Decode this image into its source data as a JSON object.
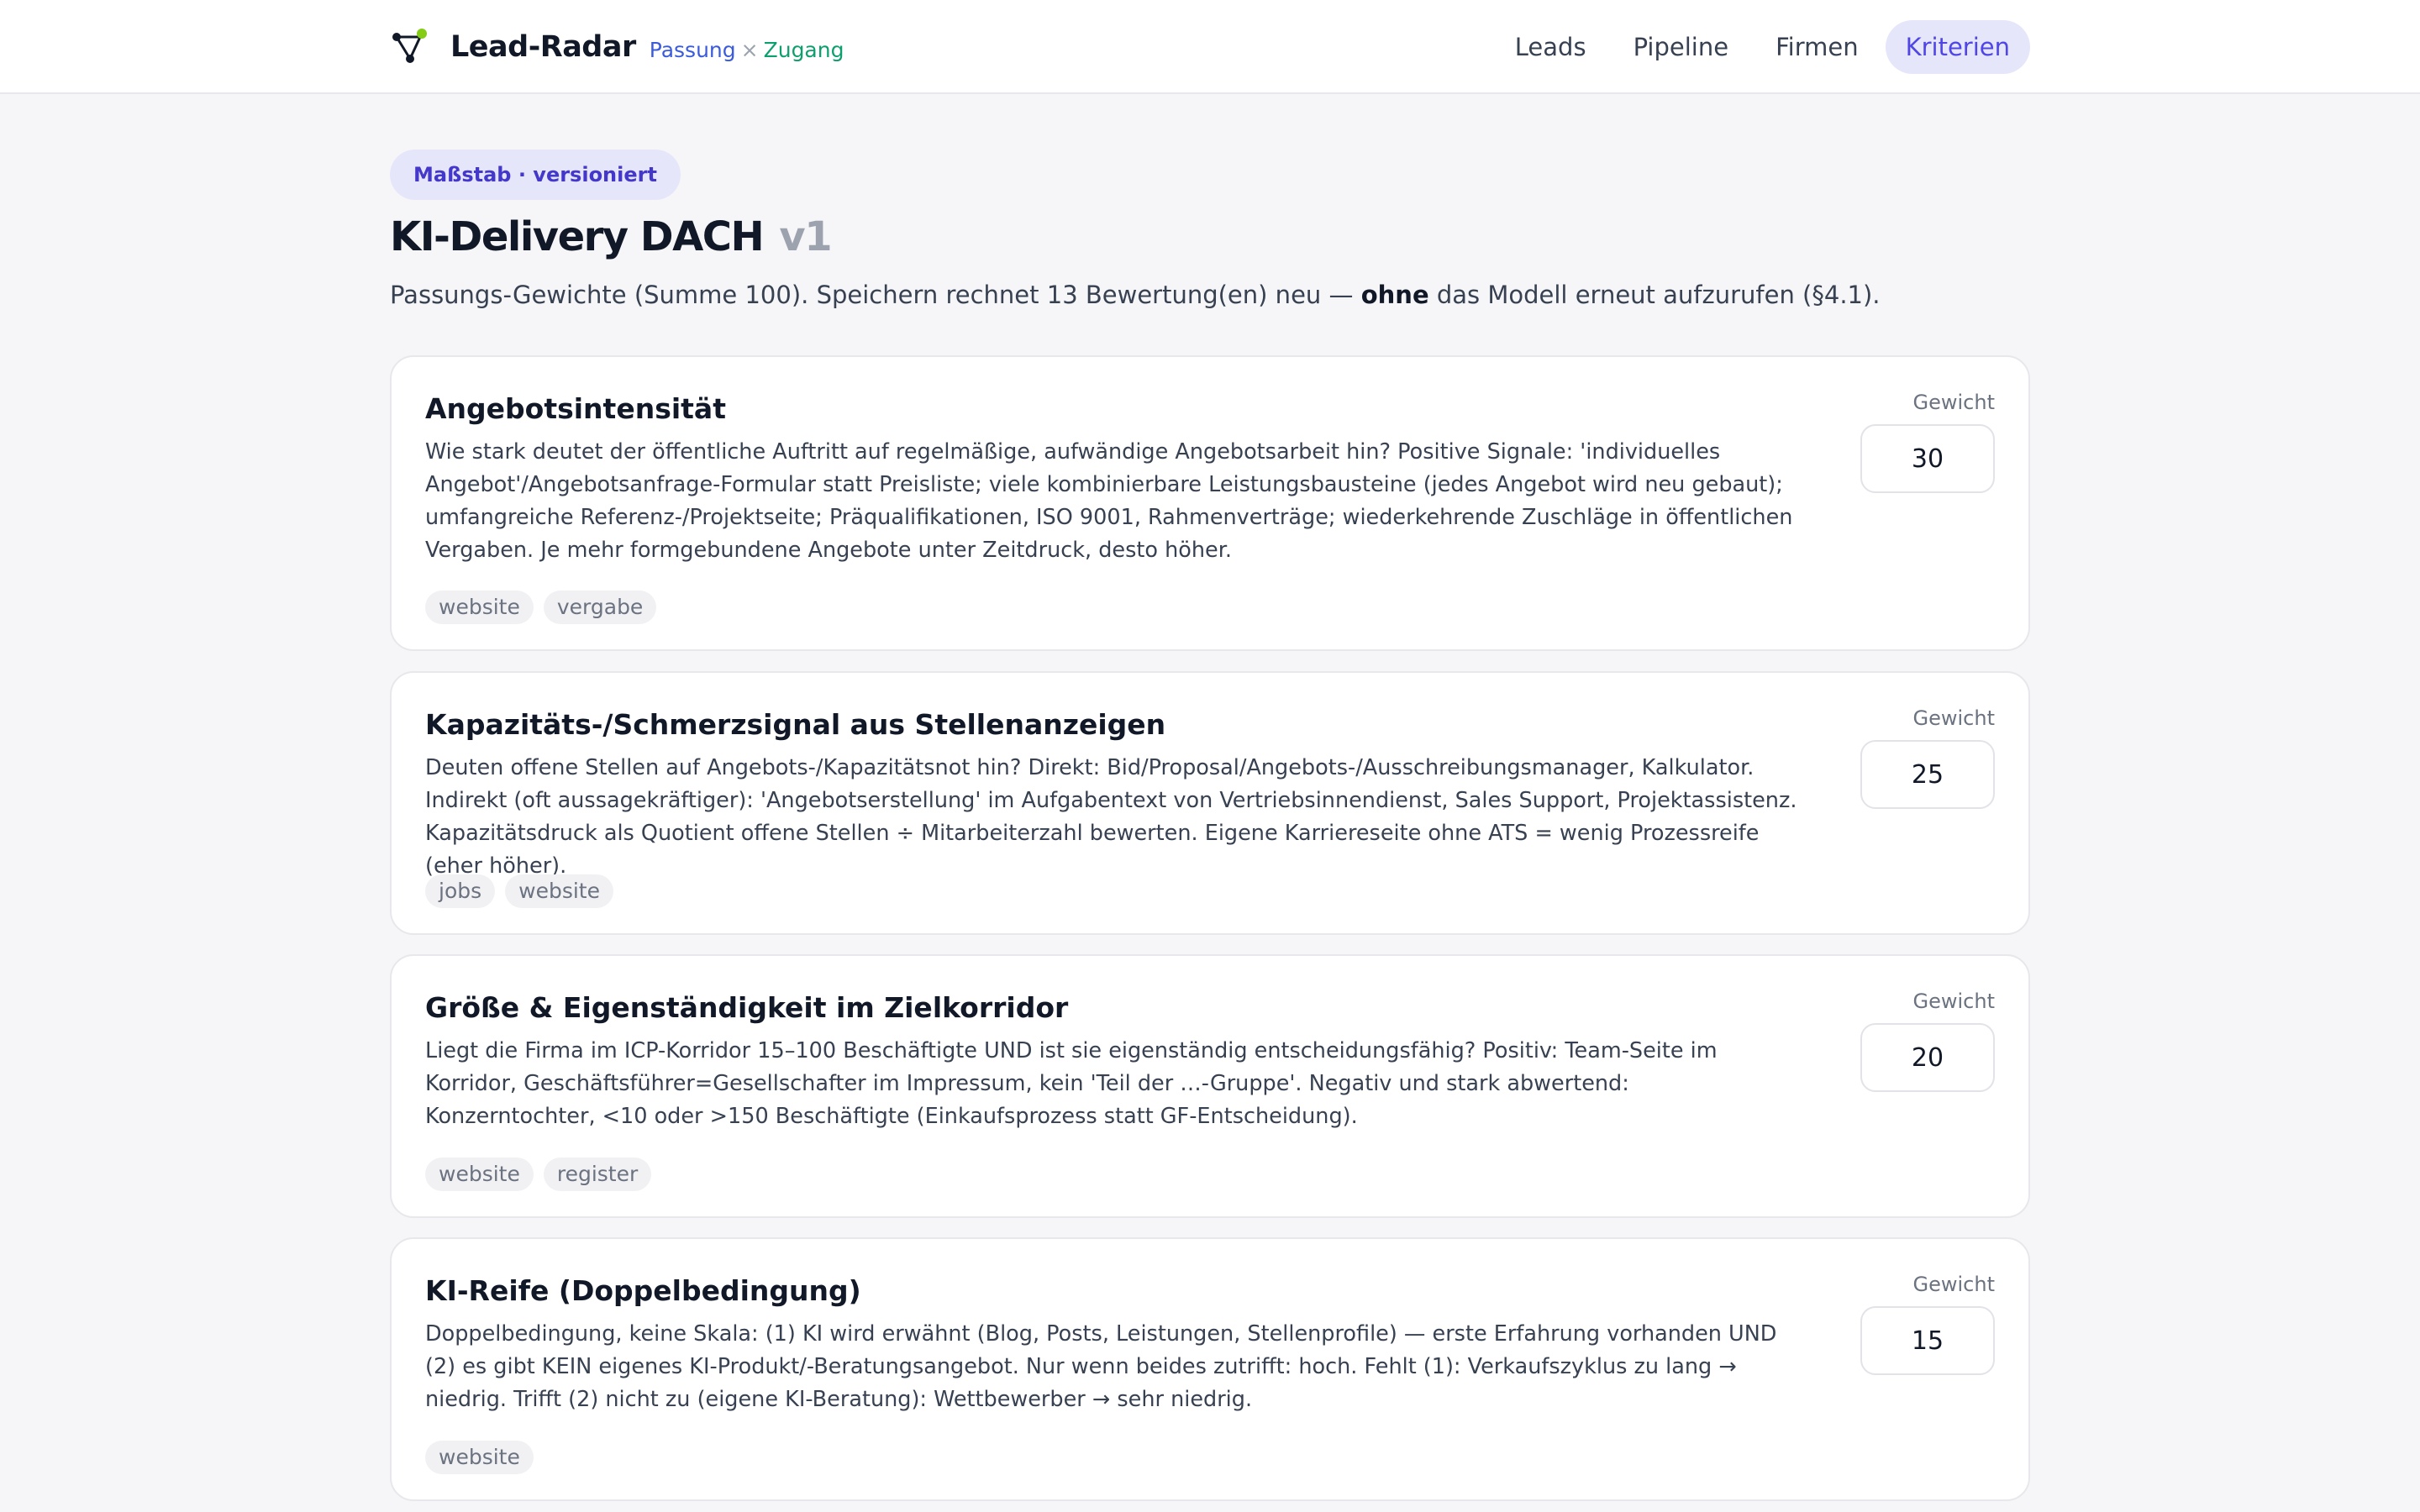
{
  "header": {
    "brand_name": "Lead-Radar",
    "tagline": {
      "left": "Passung",
      "sep": "×",
      "right": "Zugang"
    },
    "nav": [
      {
        "label": "Leads",
        "active": false
      },
      {
        "label": "Pipeline",
        "active": false
      },
      {
        "label": "Firmen",
        "active": false
      },
      {
        "label": "Kriterien",
        "active": true
      }
    ]
  },
  "page": {
    "badge": "Maßstab · versioniert",
    "title": "KI-Delivery DACH",
    "version": "v1",
    "subtitle_pre": "Passungs-Gewichte (Summe 100). Speichern rechnet 13 Bewertung(en) neu — ",
    "subtitle_bold": "ohne",
    "subtitle_post": " das Modell erneut aufzurufen (§4.1)."
  },
  "weight_label": "Gewicht",
  "criteria": [
    {
      "title": "Angebotsintensität",
      "description": "Wie stark deutet der öffentliche Auftritt auf regelmäßige, aufwändige Angebotsarbeit hin? Positive Signale: 'individuelles Angebot'/Angebotsanfrage-Formular statt Preisliste; viele kombinierbare Leistungsbausteine (jedes Angebot wird neu gebaut); umfangreiche Referenz-/Projektseite; Präqualifikationen, ISO 9001, Rahmenverträge; wiederkehrende Zuschläge in öffentlichen Vergaben. Je mehr formgebundene Angebote unter Zeitdruck, desto höher.",
      "tags": [
        "website",
        "vergabe"
      ],
      "weight": "30"
    },
    {
      "title": "Kapazitäts-/Schmerzsignal aus Stellenanzeigen",
      "description": "Deuten offene Stellen auf Angebots-/Kapazitätsnot hin? Direkt: Bid/Proposal/Angebots-/Ausschreibungsmanager, Kalkulator. Indirekt (oft aussagekräftiger): 'Angebotserstellung' im Aufgabentext von Vertriebsinnendienst, Sales Support, Projektassistenz. Kapazitätsdruck als Quotient offene Stellen ÷ Mitarbeiterzahl bewerten. Eigene Karriereseite ohne ATS = wenig Prozessreife (eher höher).",
      "tags": [
        "jobs",
        "website"
      ],
      "weight": "25"
    },
    {
      "title": "Größe & Eigenständigkeit im Zielkorridor",
      "description": "Liegt die Firma im ICP-Korridor 15–100 Beschäftigte UND ist sie eigenständig entscheidungsfähig? Positiv: Team-Seite im Korridor, Geschäftsführer=Gesellschafter im Impressum, kein 'Teil der …-Gruppe'. Negativ und stark abwertend: Konzerntochter, <10 oder >150 Beschäftigte (Einkaufsprozess statt GF-Entscheidung).",
      "tags": [
        "website",
        "register"
      ],
      "weight": "20"
    },
    {
      "title": "KI-Reife (Doppelbedingung)",
      "description": "Doppelbedingung, keine Skala: (1) KI wird erwähnt (Blog, Posts, Leistungen, Stellenprofile) — erste Erfahrung vorhanden UND (2) es gibt KEIN eigenes KI-Produkt/-Beratungsangebot. Nur wenn beides zutrifft: hoch. Fehlt (1): Verkaufszyklus zu lang → niedrig. Trifft (2) nicht zu (eigene KI-Beratung): Wettbewerber → sehr niedrig.",
      "tags": [
        "website"
      ],
      "weight": "15"
    }
  ]
}
